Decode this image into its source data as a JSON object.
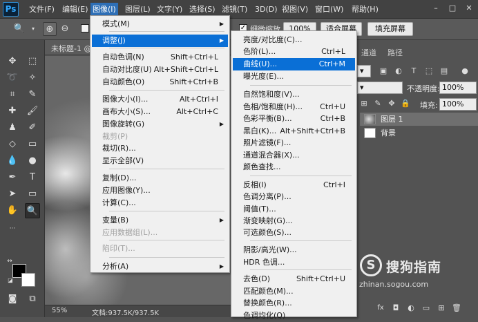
{
  "app": {
    "logo": "Ps"
  },
  "menubar": {
    "items": [
      "文件(F)",
      "编辑(E)",
      "图像(I)",
      "图层(L)",
      "文字(Y)",
      "选择(S)",
      "滤镜(T)",
      "3D(D)",
      "视图(V)",
      "窗口(W)",
      "帮助(H)"
    ]
  },
  "options": {
    "scrubby_zoom": "细微缩放",
    "zoom_value": "100%",
    "fit_screen": "适合屏幕",
    "fill_screen": "填充屏幕"
  },
  "document": {
    "tab": "未标题-1 @",
    "zoom": "55%",
    "doc_info": "文档:937.5K/937.5K"
  },
  "panel": {
    "tabs": [
      "通道",
      "路径"
    ],
    "opacity_label": "不透明度:",
    "opacity_value": "100%",
    "fill_label": "填充:",
    "fill_value": "100%",
    "layers": [
      "图层 1",
      "背景"
    ]
  },
  "watermark": {
    "text": "搜狗指南",
    "symbol": "S",
    "url": "zhinan.sogou.com"
  },
  "image_menu": {
    "items": [
      {
        "label": "模式(M)",
        "shortcut": "",
        "submenu": true
      },
      {
        "label": "调整(J)",
        "shortcut": "",
        "submenu": true,
        "highlight": true
      },
      {
        "label": "自动色调(N)",
        "shortcut": "Shift+Ctrl+L"
      },
      {
        "label": "自动对比度(U)",
        "shortcut": "Alt+Shift+Ctrl+L"
      },
      {
        "label": "自动颜色(O)",
        "shortcut": "Shift+Ctrl+B"
      },
      {
        "label": "图像大小(I)...",
        "shortcut": "Alt+Ctrl+I"
      },
      {
        "label": "画布大小(S)...",
        "shortcut": "Alt+Ctrl+C"
      },
      {
        "label": "图像旋转(G)",
        "shortcut": "",
        "submenu": true
      },
      {
        "label": "裁剪(P)",
        "shortcut": "",
        "disabled": true
      },
      {
        "label": "裁切(R)...",
        "shortcut": ""
      },
      {
        "label": "显示全部(V)",
        "shortcut": ""
      },
      {
        "label": "复制(D)...",
        "shortcut": ""
      },
      {
        "label": "应用图像(Y)...",
        "shortcut": ""
      },
      {
        "label": "计算(C)...",
        "shortcut": ""
      },
      {
        "label": "变量(B)",
        "shortcut": "",
        "submenu": true
      },
      {
        "label": "应用数据组(L)...",
        "shortcut": "",
        "disabled": true
      },
      {
        "label": "陷印(T)...",
        "shortcut": "",
        "disabled": true
      },
      {
        "label": "分析(A)",
        "shortcut": "",
        "submenu": true
      }
    ]
  },
  "adjust_menu": {
    "items": [
      {
        "label": "亮度/对比度(C)...",
        "shortcut": ""
      },
      {
        "label": "色阶(L)...",
        "shortcut": "Ctrl+L"
      },
      {
        "label": "曲线(U)...",
        "shortcut": "Ctrl+M",
        "highlight": true
      },
      {
        "label": "曝光度(E)...",
        "shortcut": ""
      },
      {
        "label": "自然饱和度(V)...",
        "shortcut": ""
      },
      {
        "label": "色相/饱和度(H)...",
        "shortcut": "Ctrl+U"
      },
      {
        "label": "色彩平衡(B)...",
        "shortcut": "Ctrl+B"
      },
      {
        "label": "黑白(K)...",
        "shortcut": "Alt+Shift+Ctrl+B"
      },
      {
        "label": "照片滤镜(F)...",
        "shortcut": ""
      },
      {
        "label": "通道混合器(X)...",
        "shortcut": ""
      },
      {
        "label": "颜色查找...",
        "shortcut": ""
      },
      {
        "label": "反相(I)",
        "shortcut": "Ctrl+I"
      },
      {
        "label": "色调分离(P)...",
        "shortcut": ""
      },
      {
        "label": "阈值(T)...",
        "shortcut": ""
      },
      {
        "label": "渐变映射(G)...",
        "shortcut": ""
      },
      {
        "label": "可选颜色(S)...",
        "shortcut": ""
      },
      {
        "label": "阴影/高光(W)...",
        "shortcut": ""
      },
      {
        "label": "HDR 色调...",
        "shortcut": ""
      },
      {
        "label": "去色(D)",
        "shortcut": "Shift+Ctrl+U"
      },
      {
        "label": "匹配颜色(M)...",
        "shortcut": ""
      },
      {
        "label": "替换颜色(R)...",
        "shortcut": ""
      },
      {
        "label": "色调均化(Q)",
        "shortcut": ""
      }
    ]
  },
  "colors": {
    "accent": "#0a6fd6",
    "menu_bg": "#f0f0f0",
    "app_bg": "#535353"
  }
}
